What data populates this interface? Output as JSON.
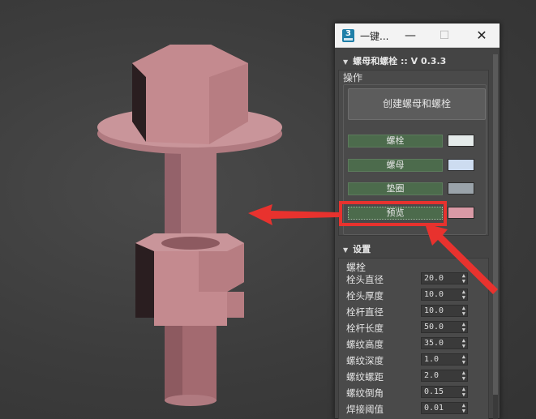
{
  "window": {
    "title": "一键...",
    "app_icon": "3",
    "controls": {
      "minimize": "—",
      "maximize": "☐",
      "close": "✕"
    }
  },
  "rollout_main": {
    "title": "螺母和螺栓 :: V 0.3.3",
    "group_label": "操作",
    "create_button": "创建螺母和螺栓",
    "parts": [
      {
        "label": "螺栓",
        "color": "#e5ebea"
      },
      {
        "label": "螺母",
        "color": "#cddcf0"
      },
      {
        "label": "垫圈",
        "color": "#9aa3aa"
      },
      {
        "label": "预览",
        "color": "#d99aa6"
      }
    ]
  },
  "rollout_settings": {
    "title": "设置",
    "section_label": "螺栓",
    "rows": [
      {
        "label": "栓头直径",
        "value": "20.0"
      },
      {
        "label": "栓头厚度",
        "value": "10.0"
      },
      {
        "label": "栓杆直径",
        "value": "10.0"
      },
      {
        "label": "栓杆长度",
        "value": "50.0"
      },
      {
        "label": "螺纹高度",
        "value": "35.0"
      },
      {
        "label": "螺纹深度",
        "value": "1.0"
      },
      {
        "label": "螺纹螺距",
        "value": "2.0"
      },
      {
        "label": "螺纹倒角",
        "value": "0.15"
      },
      {
        "label": "焊接阈值",
        "value": "0.01"
      }
    ]
  },
  "colors": {
    "model": "#c48a8f",
    "annotation": "#e8322e",
    "part_button": "#4c6b4c"
  }
}
